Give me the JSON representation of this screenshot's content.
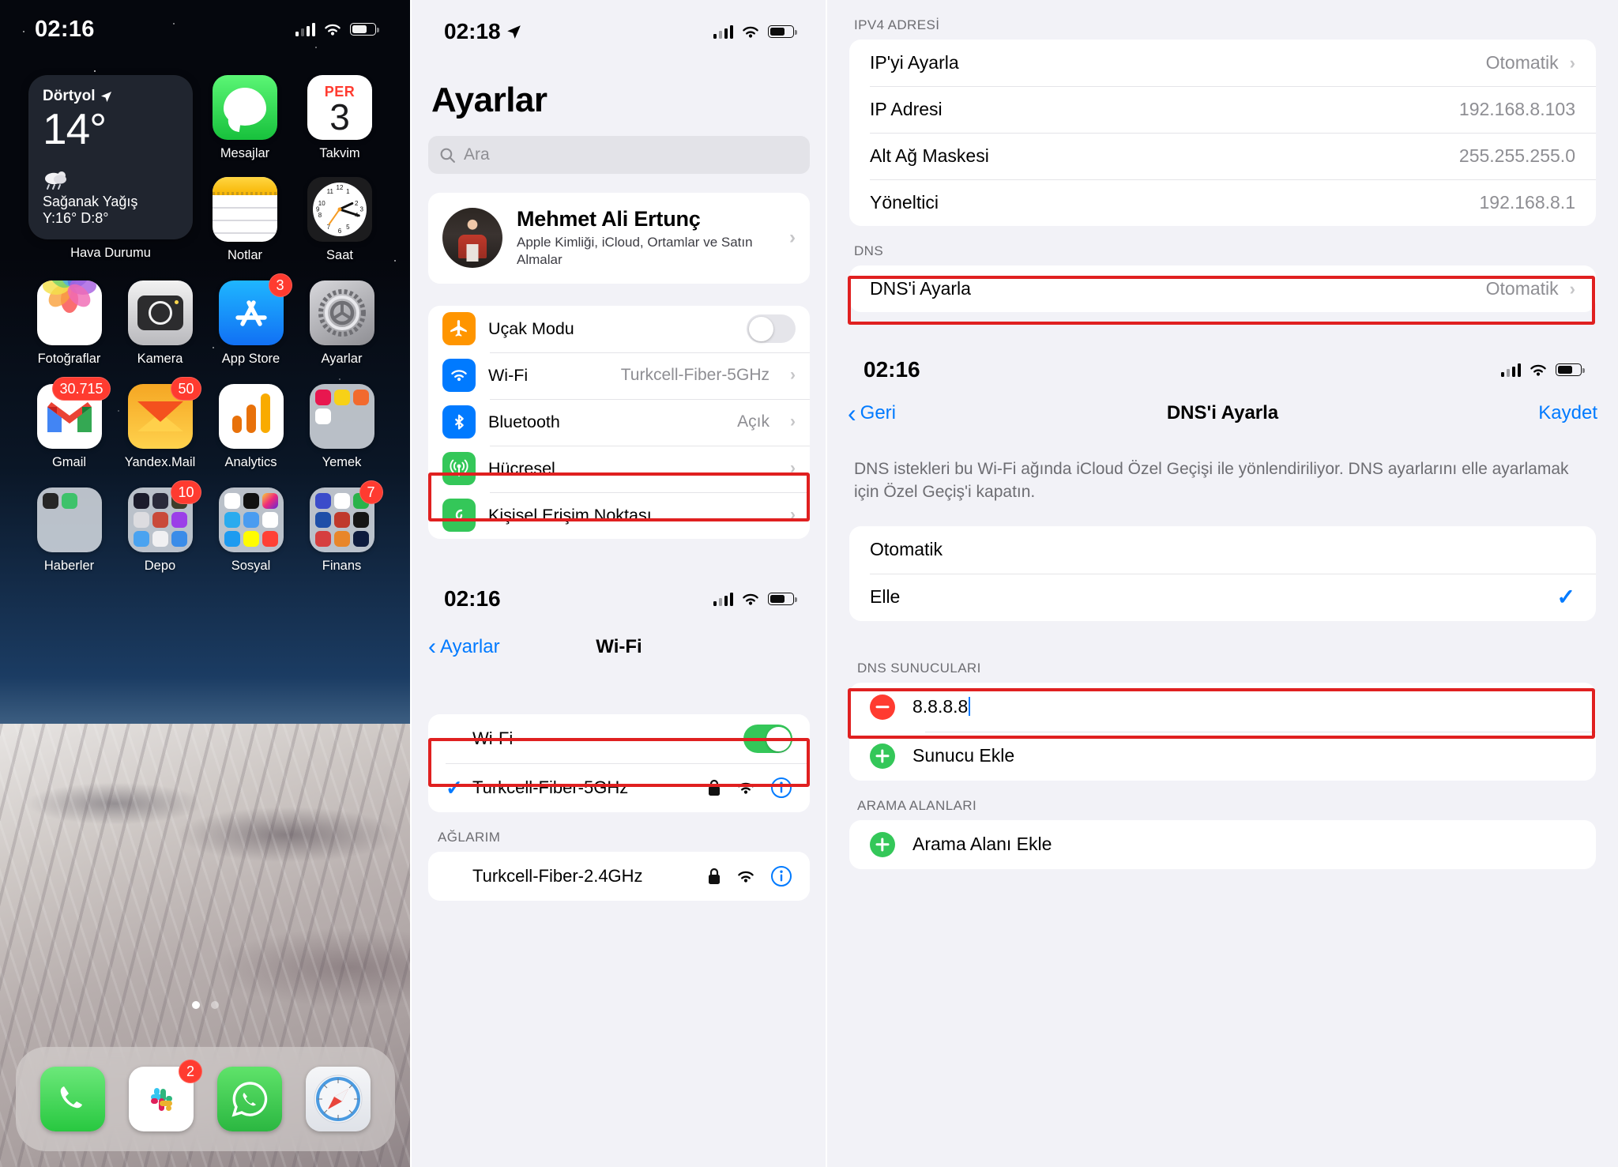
{
  "home": {
    "status": {
      "time": "02:16"
    },
    "widget": {
      "city": "Dörtyol",
      "temp": "14°",
      "condition": "Sağanak Yağış",
      "highlow": "Y:16° D:8°",
      "label": "Hava Durumu"
    },
    "apps_row1": [
      {
        "name": "Mesajlar"
      },
      {
        "name": "Takvim",
        "cal_day_name": "PER",
        "cal_day_num": "3"
      }
    ],
    "apps_row2": [
      {
        "name": "Notlar"
      },
      {
        "name": "Saat"
      }
    ],
    "apps_row3": [
      {
        "name": "Fotoğraflar",
        "badge": ""
      },
      {
        "name": "Kamera",
        "badge": ""
      },
      {
        "name": "App Store",
        "badge": "3"
      },
      {
        "name": "Ayarlar",
        "badge": ""
      }
    ],
    "apps_row4": [
      {
        "name": "Gmail",
        "badge": "30.715"
      },
      {
        "name": "Yandex.Mail",
        "badge": "50"
      },
      {
        "name": "Analytics",
        "badge": ""
      },
      {
        "name": "Yemek",
        "badge": ""
      }
    ],
    "apps_row5": [
      {
        "name": "Haberler",
        "badge": ""
      },
      {
        "name": "Depo",
        "badge": "10"
      },
      {
        "name": "Sosyal",
        "badge": ""
      },
      {
        "name": "Finans",
        "badge": "7"
      }
    ],
    "dock": [
      {
        "name": "Telefon",
        "badge": ""
      },
      {
        "name": "Slack",
        "badge": "2"
      },
      {
        "name": "WhatsApp",
        "badge": ""
      },
      {
        "name": "Safari",
        "badge": ""
      }
    ],
    "clock_numbers": [
      "12",
      "1",
      "2",
      "3",
      "4",
      "5",
      "6",
      "7",
      "8",
      "9",
      "10",
      "11"
    ]
  },
  "settings": {
    "status": {
      "time": "02:18"
    },
    "title": "Ayarlar",
    "search": {
      "placeholder": "Ara",
      "icon": "search-icon"
    },
    "profile": {
      "name": "Mehmet Ali Ertunç",
      "subtitle": "Apple Kimliği, iCloud, Ortamlar ve Satın Almalar"
    },
    "rows": [
      {
        "label": "Uçak Modu",
        "value": "",
        "control": "toggle-off",
        "icon": "airplane-icon",
        "color": "#ff9500"
      },
      {
        "label": "Wi-Fi",
        "value": "Turkcell-Fiber-5GHz",
        "control": "chevron",
        "icon": "wifi-icon",
        "color": "#007aff",
        "highlighted": true
      },
      {
        "label": "Bluetooth",
        "value": "Açık",
        "control": "chevron",
        "icon": "bluetooth-icon",
        "color": "#007aff"
      },
      {
        "label": "Hücresel",
        "value": "",
        "control": "chevron",
        "icon": "cellular-icon",
        "color": "#34c759"
      },
      {
        "label": "Kişisel Erişim Noktası",
        "value": "",
        "control": "chevron",
        "icon": "hotspot-icon",
        "color": "#34c759"
      }
    ]
  },
  "wifi": {
    "status": {
      "time": "02:16"
    },
    "back_label": "Ayarlar",
    "title": "Wi-Fi",
    "toggle_row": {
      "label": "Wi-Fi",
      "state": "on"
    },
    "connected": {
      "name": "Turkcell-Fiber-5GHz",
      "checked": true,
      "lock_icon": "lock-icon",
      "signal_icon": "wifi-icon",
      "info_icon": "info-circle-icon",
      "highlighted": true
    },
    "group_header": "AĞLARIM",
    "networks": [
      {
        "name": "Turkcell-Fiber-2.4GHz",
        "lock_icon": "lock-icon",
        "signal_icon": "wifi-icon",
        "info_icon": "info-circle-icon"
      }
    ]
  },
  "ipv4": {
    "group_header": "IPV4 ADRESİ",
    "rows": [
      {
        "label": "IP'yi Ayarla",
        "value": "Otomatik",
        "chevron": true
      },
      {
        "label": "IP Adresi",
        "value": "192.168.8.103",
        "chevron": false
      },
      {
        "label": "Alt Ağ Maskesi",
        "value": "255.255.255.0",
        "chevron": false
      },
      {
        "label": "Yöneltici",
        "value": "192.168.8.1",
        "chevron": false
      }
    ],
    "dns_header": "DNS",
    "dns_row": {
      "label": "DNS'i Ayarla",
      "value": "Otomatik",
      "chevron": true,
      "highlighted": true
    }
  },
  "dns_config": {
    "status": {
      "time": "02:16"
    },
    "back_label": "Geri",
    "title": "DNS'i Ayarla",
    "save_label": "Kaydet",
    "description": "DNS istekleri bu Wi-Fi ağında iCloud Özel Geçişi ile yönlendiriliyor. DNS ayarlarını elle ayarlamak için Özel Geçiş'i kapatın.",
    "options": [
      {
        "label": "Otomatik",
        "selected": false
      },
      {
        "label": "Elle",
        "selected": true
      }
    ],
    "servers_header": "DNS SUNUCULARI",
    "servers": [
      {
        "value": "8.8.8.8",
        "action": "remove",
        "highlighted": true,
        "editing": true
      }
    ],
    "add_server_label": "Sunucu Ekle",
    "domains_header": "ARAMA ALANLARI",
    "add_domain_label": "Arama Alanı Ekle"
  },
  "colors": {
    "accent_blue": "#007aff",
    "green": "#34c759",
    "red_highlight": "#e02020",
    "orange": "#ff9500",
    "gray_text": "#8e8e93"
  }
}
